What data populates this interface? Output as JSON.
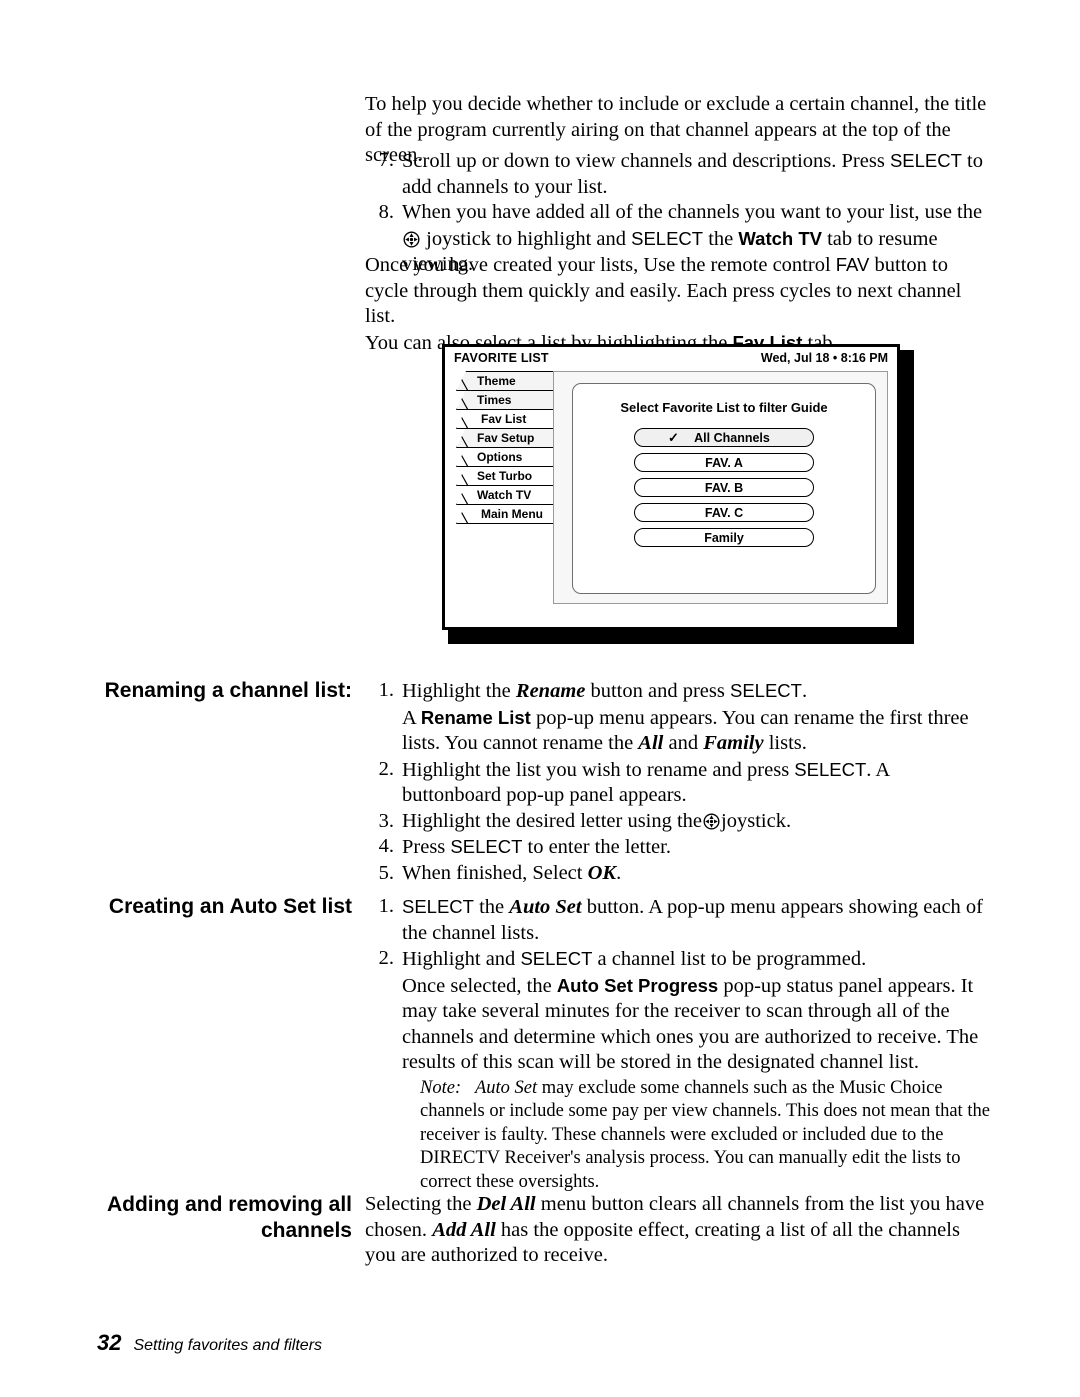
{
  "page": {
    "number": "32",
    "footer_title": "Setting favorites and filters"
  },
  "intro": {
    "paragraph": "To help you decide whether to include or exclude a certain channel, the title of the program currently airing on that channel appears at the top of the screen."
  },
  "steps_top": [
    {
      "num": "7.",
      "text_a": "Scroll up or down to view channels and descriptions. Press ",
      "kw": "SELECT",
      "text_b": " to add channels to your list."
    },
    {
      "num": "8.",
      "text_a": "When you have added all of the channels you want to your list, use the ",
      "icon": "joystick-icon",
      "text_b": " joystick to highlight and ",
      "kw": "SELECT",
      "text_c": " the ",
      "kw2": "Watch TV",
      "text_d": " tab to resume viewing."
    }
  ],
  "fav_para": {
    "line1": "Once you have created your lists, Use the remote control ",
    "kw": "FAV",
    "line2": " button to cycle through them quickly and easily. Each press cycles to next channel list.",
    "line3": "You can also select a list by highlighting the ",
    "kw2": "Fav List",
    "line4": " tab."
  },
  "tv": {
    "title": "FAVORITE LIST",
    "clock": "Wed, Jul 18 • 8:16 PM",
    "tabs": [
      {
        "label": "Theme"
      },
      {
        "label": "Times"
      },
      {
        "label": "Fav List"
      },
      {
        "label": "Fav Setup"
      },
      {
        "label": "Options"
      },
      {
        "label": "Set Turbo"
      },
      {
        "label": "Watch TV"
      },
      {
        "label": "Main Menu"
      }
    ],
    "panel_title": "Select Favorite List to filter Guide",
    "buttons": [
      {
        "label": "All Channels",
        "selected": true,
        "check": "✓"
      },
      {
        "label": "FAV. A",
        "selected": false
      },
      {
        "label": "FAV. B",
        "selected": false
      },
      {
        "label": "FAV. C",
        "selected": false
      },
      {
        "label": "Family",
        "selected": false
      }
    ]
  },
  "sections": [
    {
      "heading": "Renaming a channel list:",
      "steps": [
        {
          "num": "1.",
          "a": "Highlight the ",
          "i1": "Rename",
          "b": " button and press ",
          "kw": "SELECT",
          "c": ".",
          "sub_a": "A ",
          "sub_kw": "Rename List",
          "sub_b": " pop-up menu appears. You can rename the first three lists. You cannot rename the ",
          "sub_i1": "All",
          "sub_c": " and ",
          "sub_i2": "Family",
          "sub_d": " lists."
        },
        {
          "num": "2.",
          "a": "Highlight the list you wish to rename and press ",
          "kw": "SELECT",
          "b": ". A buttonboard pop-up panel appears."
        },
        {
          "num": "3.",
          "a": "Highlight the desired letter using the",
          "icon": "joystick-icon",
          "b": "joystick."
        },
        {
          "num": "4.",
          "a": "Press ",
          "kw": "SELECT",
          "b": " to enter the letter."
        },
        {
          "num": "5.",
          "a": "When finished, Select ",
          "i1": "OK",
          "b": "."
        }
      ]
    },
    {
      "heading": "Creating an Auto Set list",
      "steps": [
        {
          "num": "1.",
          "kw": "SELECT",
          "a": " the ",
          "i1": "Auto Set",
          "b": " button. A pop-up menu appears showing each of the channel lists."
        },
        {
          "num": "2.",
          "a": "Highlight and ",
          "kw": "SELECT",
          "b": " a channel list to be programmed.",
          "sub_a": "Once selected, the ",
          "sub_kw": "Auto Set Progress",
          "sub_b": " pop-up status panel appears. It may take several minutes for the receiver to scan through all of the channels and determine which ones you are authorized to receive. The results of this scan will be stored in the designated channel list."
        }
      ],
      "note": {
        "label": "Note:",
        "i1": "Auto Set",
        "text": " may exclude some channels such as the Music Choice channels or include some pay per view channels. This does not mean that the receiver is faulty. These channels were excluded or included due to the DIRECTV Receiver's analysis process. You can manually edit the lists to correct these oversights."
      }
    },
    {
      "heading_line1": "Adding and removing all",
      "heading_line2": "channels",
      "body_a": "Selecting the ",
      "body_i1": "Del All",
      "body_b": " menu button clears all channels from the list you have chosen. ",
      "body_i2": "Add All",
      "body_c": " has the opposite effect, creating a list of all the channels you are authorized to receive."
    }
  ]
}
